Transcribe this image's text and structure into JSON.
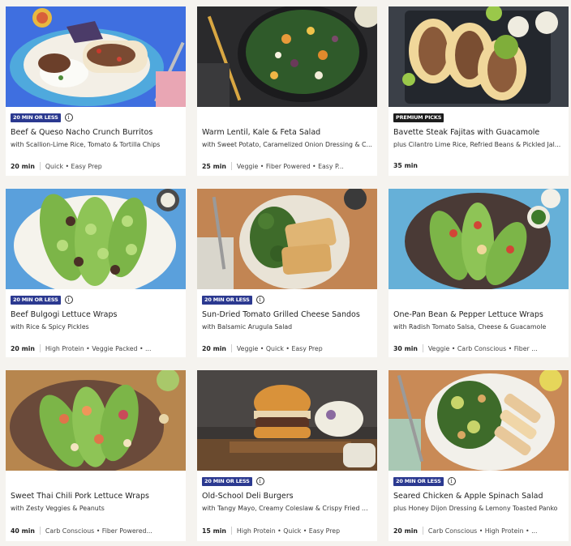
{
  "cards": [
    {
      "badge": "20 MIN OR LESS",
      "badge_type": "time",
      "title": "Beef & Queso Nacho Crunch Burritos",
      "subtitle": "with Scallion-Lime Rice, Tomato & Tortilla Chips",
      "time": "20 min",
      "tags": "Quick • Easy Prep"
    },
    {
      "badge": "",
      "badge_type": "none",
      "title": "Warm Lentil, Kale & Feta Salad",
      "subtitle": "with Sweet Potato, Caramelized Onion Dressing & C...",
      "time": "25 min",
      "tags": "Veggie • Fiber Powered • Easy P..."
    },
    {
      "badge": "PREMIUM PICKS",
      "badge_type": "premium",
      "title": "Bavette Steak Fajitas with Guacamole",
      "subtitle": "plus Cilantro Lime Rice, Refried Beans & Pickled Jal...",
      "time": "35 min",
      "tags": ""
    },
    {
      "badge": "20 MIN OR LESS",
      "badge_type": "time",
      "title": "Beef Bulgogi Lettuce Wraps",
      "subtitle": "with Rice & Spicy Pickles",
      "time": "20 min",
      "tags": "High Protein • Veggie Packed • ..."
    },
    {
      "badge": "20 MIN OR LESS",
      "badge_type": "time",
      "title": "Sun-Dried Tomato Grilled Cheese Sandos",
      "subtitle": "with Balsamic Arugula Salad",
      "time": "20 min",
      "tags": "Veggie • Quick • Easy Prep"
    },
    {
      "badge": "",
      "badge_type": "none",
      "title": "One-Pan Bean & Pepper Lettuce Wraps",
      "subtitle": "with Radish Tomato Salsa, Cheese & Guacamole",
      "time": "30 min",
      "tags": "Veggie • Carb Conscious • Fiber ..."
    },
    {
      "badge": "",
      "badge_type": "none",
      "title": "Sweet Thai Chili Pork Lettuce Wraps",
      "subtitle": "with Zesty Veggies & Peanuts",
      "time": "40 min",
      "tags": "Carb Conscious • Fiber Powered..."
    },
    {
      "badge": "20 MIN OR LESS",
      "badge_type": "time",
      "title": "Old-School Deli Burgers",
      "subtitle": "with Tangy Mayo, Creamy Coleslaw & Crispy Fried O...",
      "time": "15 min",
      "tags": "High Protein • Quick • Easy Prep"
    },
    {
      "badge": "20 MIN OR LESS",
      "badge_type": "time",
      "title": "Seared Chicken & Apple Spinach Salad",
      "subtitle": "plus Honey Dijon Dressing & Lemony Toasted Panko",
      "time": "20 min",
      "tags": "Carb Conscious • High Protein • ..."
    }
  ],
  "info_symbol": "i",
  "colors": {
    "badge_time": "#2b3990",
    "badge_premium": "#1c1c1c",
    "page_bg": "#f5f3ef"
  }
}
